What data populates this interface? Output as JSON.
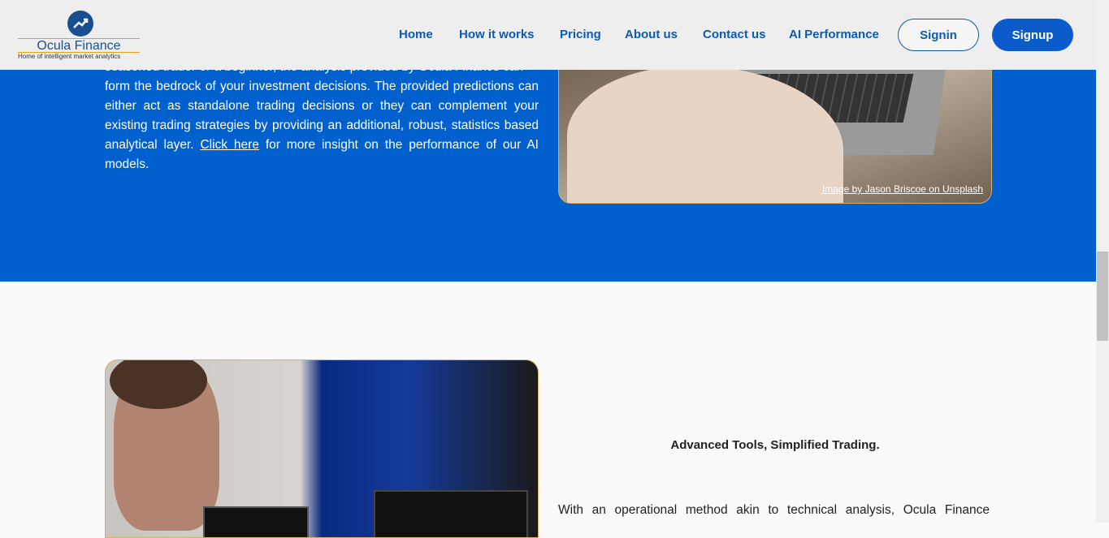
{
  "brand": {
    "name": "Ocula Finance",
    "tagline": "Home of intelligent market analytics",
    "logo_icon": "trending-up-icon",
    "accent_color": "#0c5bcb",
    "gold_color": "#e0a020"
  },
  "nav": {
    "links": [
      "Home",
      "How it works",
      "Pricing",
      "About us",
      "Contact us",
      "AI Performance"
    ],
    "signin_label": "Signin",
    "signup_label": "Signup"
  },
  "hero": {
    "partial_line": "seasoned trader or a beginner, the analysis provided by Ocula Finance can",
    "text_before_link": "form the bedrock of your investment decisions. The provided predictions can either act as standalone trading decisions or they can complement your existing trading strategies by providing an additional, robust, statistics based analytical layer.",
    "link_label": "Click here",
    "text_after_link": "for more insight on the performance of our AI models.",
    "image_credit": "Image by Jason Briscoe on Unsplash",
    "background_color": "#0060cd"
  },
  "section2": {
    "title": "Advanced Tools, Simplified Trading.",
    "text": "With an operational method akin to technical analysis, Ocula Finance"
  }
}
